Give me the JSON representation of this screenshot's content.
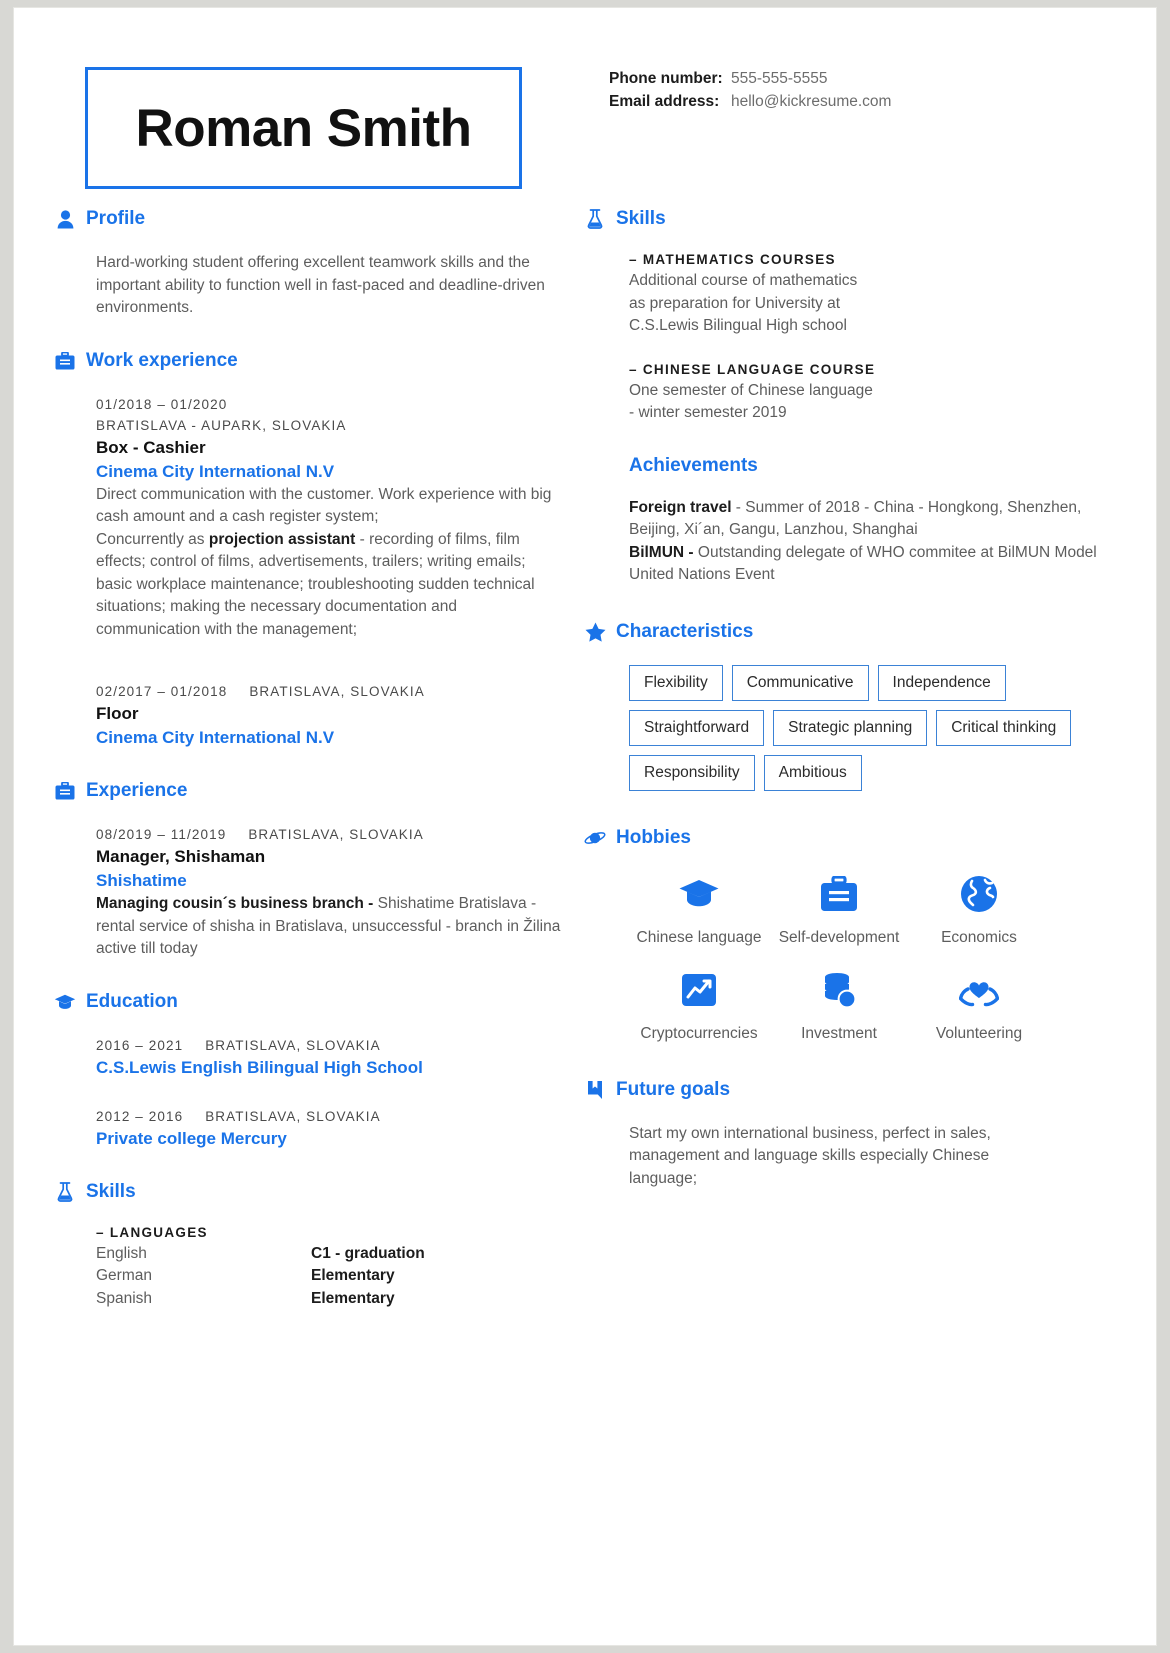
{
  "colors": {
    "accent": "#1a73e8",
    "tag_border": "#3b82d6",
    "body_text": "#5d5d5d"
  },
  "header": {
    "name": "Roman Smith",
    "contact": [
      {
        "label": "Phone number:",
        "value": "555-555-5555"
      },
      {
        "label": "Email address:",
        "value": "hello@kickresume.com"
      }
    ]
  },
  "left": {
    "profile": {
      "title": "Profile",
      "icon": "person-icon",
      "text": "Hard-working student offering excellent teamwork skills and the important ability to function well in fast-paced and deadline-driven environments."
    },
    "work_experience": {
      "title": "Work experience",
      "icon": "briefcase-icon",
      "entries": [
        {
          "dates": "01/2018 – 01/2020",
          "location": "BRATISLAVA - AUPARK, SLOVAKIA",
          "stacked": true,
          "position": "Box - Cashier",
          "company": "Cinema City International N.V",
          "desc_1": "Direct communication with the customer. Work experience with big cash amount and a cash register system;",
          "desc_2_pre": "Concurrently as ",
          "desc_2_bold": "projection assistant",
          "desc_2_post": " - recording of films, film effects; control of films, advertisements, trailers; writing emails; basic workplace maintenance; troubleshooting sudden technical situations; making the necessary documentation and communication with the management;"
        },
        {
          "dates": "02/2017 – 01/2018",
          "location": "BRATISLAVA, SLOVAKIA",
          "stacked": false,
          "position": "Floor",
          "company": "Cinema City International N.V",
          "desc_1": "",
          "desc_2_pre": "",
          "desc_2_bold": "",
          "desc_2_post": ""
        }
      ]
    },
    "experience": {
      "title": "Experience",
      "icon": "briefcase-icon",
      "dates": "08/2019 – 11/2019",
      "location": "BRATISLAVA, SLOVAKIA",
      "position": "Manager, Shishaman",
      "company": "Shishatime",
      "desc_bold": "Managing cousin´s business branch - ",
      "desc_rest": "Shishatime Bratislava - rental service of shisha in Bratislava, unsuccessful - branch in Žilina active till today"
    },
    "education": {
      "title": "Education",
      "icon": "graduation-cap-icon",
      "entries": [
        {
          "dates": "2016 – 2021",
          "location": "BRATISLAVA, SLOVAKIA",
          "school": "C.S.Lewis English Bilingual High School"
        },
        {
          "dates": "2012 – 2016",
          "location": "BRATISLAVA, SLOVAKIA",
          "school": "Private college Mercury"
        }
      ]
    },
    "skills": {
      "title": "Skills",
      "icon": "flask-icon",
      "subhead": "– LANGUAGES",
      "languages": [
        {
          "name": "English",
          "level": "C1 - graduation"
        },
        {
          "name": "German",
          "level": "Elementary"
        },
        {
          "name": "Spanish",
          "level": "Elementary"
        }
      ]
    }
  },
  "right": {
    "skills": {
      "title": "Skills",
      "icon": "flask-icon",
      "blocks": [
        {
          "subhead": "– MATHEMATICS COURSES",
          "text": "Additional course of mathematics as preparation for University at C.S.Lewis Bilingual High school"
        },
        {
          "subhead": "– CHINESE LANGUAGE COURSE",
          "text": "One semester of Chinese language - winter semester 2019"
        }
      ]
    },
    "achievements": {
      "title": "Achievements",
      "item_1_bold": "Foreign travel",
      "item_1_rest": " - Summer of 2018 - China - Hongkong, Shenzhen, Beijing, Xi´an, Gangu, Lanzhou, Shanghai",
      "item_2_bold": "BilMUN - ",
      "item_2_rest": "Outstanding delegate of WHO commitee at BilMUN Model United Nations Event"
    },
    "characteristics": {
      "title": "Characteristics",
      "icon": "star-icon",
      "tags": [
        "Flexibility",
        "Communicative",
        "Independence",
        "Straightforward",
        "Strategic planning",
        "Critical thinking",
        "Responsibility",
        "Ambitious"
      ]
    },
    "hobbies": {
      "title": "Hobbies",
      "icon": "planet-icon",
      "items": [
        {
          "label": "Chinese language",
          "icon": "graduation-cap-icon"
        },
        {
          "label": "Self-development",
          "icon": "briefcase-icon"
        },
        {
          "label": "Economics",
          "icon": "globe-icon"
        },
        {
          "label": "Cryptocurrencies",
          "icon": "chart-icon"
        },
        {
          "label": "Investment",
          "icon": "coins-icon"
        },
        {
          "label": "Volunteering",
          "icon": "heart-hands-icon"
        }
      ]
    },
    "future_goals": {
      "title": "Future goals",
      "icon": "bookmark-icon",
      "text": "Start my own international business, perfect in sales, management and language skills especially Chinese language;"
    }
  }
}
